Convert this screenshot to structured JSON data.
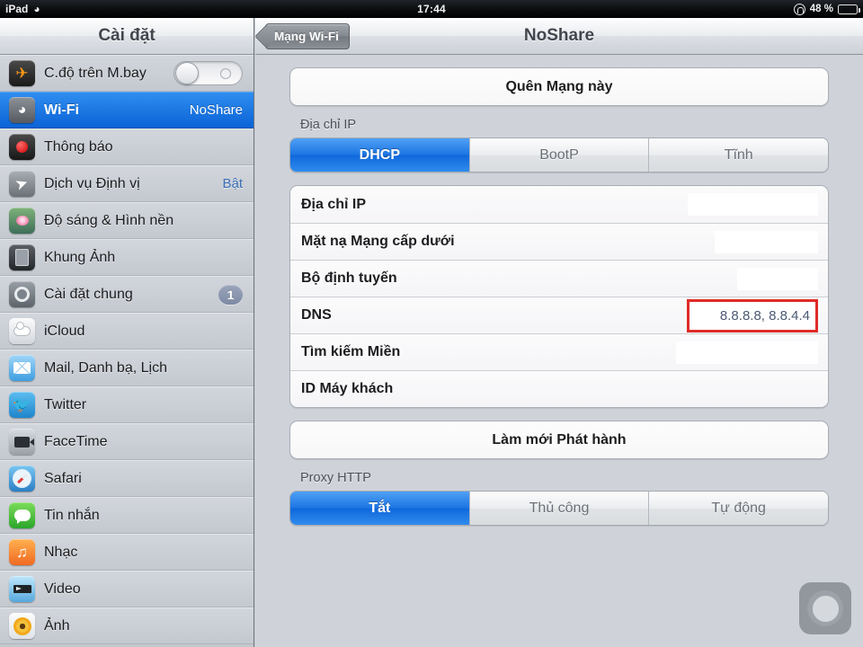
{
  "status_bar": {
    "device": "iPad",
    "wifi_icon": "wifi-icon",
    "time": "17:44",
    "rotation_lock_icon": "rotation-lock-icon",
    "battery_percent": "48 %",
    "battery_level": 48
  },
  "sidebar": {
    "title": "Cài đặt",
    "items": [
      {
        "label": "C.độ trên M.bay",
        "icon": "airplane-icon",
        "control": "toggle",
        "toggle_on": false
      },
      {
        "label": "Wi-Fi",
        "icon": "wifi-icon",
        "value": "NoShare",
        "selected": true
      },
      {
        "label": "Thông báo",
        "icon": "notifications-icon"
      },
      {
        "label": "Dịch vụ Định vị",
        "icon": "location-icon",
        "value": "Bật"
      },
      {
        "label": "Độ sáng & Hình nền",
        "icon": "brightness-wallpaper-icon"
      },
      {
        "label": "Khung Ảnh",
        "icon": "picture-frame-icon"
      },
      {
        "label": "Cài đặt chung",
        "icon": "general-settings-icon",
        "badge": "1"
      },
      {
        "label": "iCloud",
        "icon": "icloud-icon"
      },
      {
        "label": "Mail, Danh bạ, Lịch",
        "icon": "mail-icon"
      },
      {
        "label": "Twitter",
        "icon": "twitter-icon"
      },
      {
        "label": "FaceTime",
        "icon": "facetime-icon"
      },
      {
        "label": "Safari",
        "icon": "safari-icon"
      },
      {
        "label": "Tin nhắn",
        "icon": "messages-icon"
      },
      {
        "label": "Nhạc",
        "icon": "music-icon"
      },
      {
        "label": "Video",
        "icon": "video-icon"
      },
      {
        "label": "Ảnh",
        "icon": "photos-icon"
      }
    ]
  },
  "detail": {
    "back_button": "Mạng Wi-Fi",
    "title": "NoShare",
    "forget_network_button": "Quên Mạng này",
    "ip_section_label": "Địa chỉ IP",
    "ip_modes": [
      {
        "label": "DHCP",
        "active": true
      },
      {
        "label": "BootP",
        "active": false
      },
      {
        "label": "Tĩnh",
        "active": false
      }
    ],
    "ip_rows": [
      {
        "label": "Địa chỉ IP",
        "value": "",
        "redacted": true,
        "redact_width": 145
      },
      {
        "label": "Mặt nạ Mạng cấp dưới",
        "value": "",
        "redacted": true,
        "redact_width": 115
      },
      {
        "label": "Bộ định tuyến",
        "value": "",
        "redacted": true,
        "redact_width": 90
      },
      {
        "label": "DNS",
        "value": "8.8.8.8, 8.8.4.4",
        "highlighted": true
      },
      {
        "label": "Tìm kiếm Miền",
        "value": "",
        "redacted": true,
        "redact_width": 158
      },
      {
        "label": "ID Máy khách",
        "value": ""
      }
    ],
    "renew_lease_button": "Làm mới Phát hành",
    "proxy_section_label": "Proxy HTTP",
    "proxy_modes": [
      {
        "label": "Tắt",
        "active": true
      },
      {
        "label": "Thủ công",
        "active": false
      },
      {
        "label": "Tự động",
        "active": false
      }
    ]
  },
  "overlay": {
    "assistive_touch_icon": "assistive-touch-button"
  },
  "colors": {
    "accent_blue": "#1b74e2",
    "highlight_red": "#e02b27",
    "selected_row": "#0b63d6"
  }
}
